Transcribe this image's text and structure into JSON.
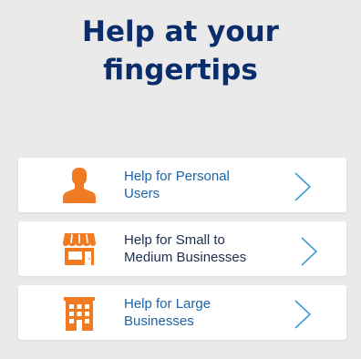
{
  "title": {
    "line1": "Help at your",
    "line2": "fingertips"
  },
  "options": [
    {
      "line1": "Help for Personal",
      "line2": "Users",
      "icon": "person-icon"
    },
    {
      "line1": "Help for Small to",
      "line2": "Medium Businesses",
      "icon": "storefront-icon"
    },
    {
      "line1": "Help for Large",
      "line2": "Businesses",
      "icon": "office-building-icon"
    }
  ],
  "colors": {
    "background": "#eaeaea",
    "title": "#0b2d6b",
    "icon": "#f07b22",
    "link": "#1c63a8",
    "link_active": "#1d2e4f",
    "chevron": "#3d9bd6"
  }
}
